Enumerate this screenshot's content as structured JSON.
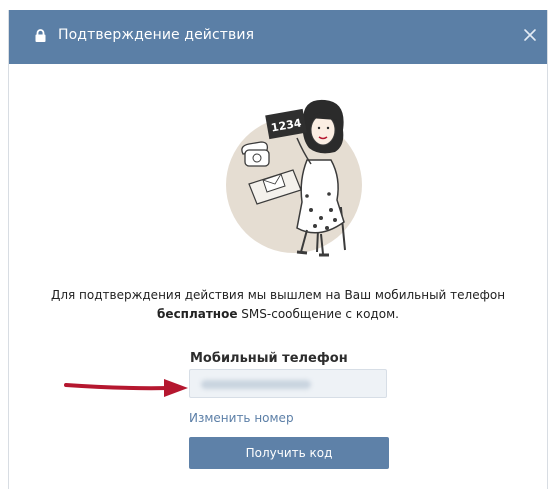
{
  "header": {
    "title": "Подтверждение действия",
    "lock_icon": "lock-icon",
    "close_icon": "close-icon",
    "background": "#5b7fa6"
  },
  "message": {
    "line1": "Для подтверждения действия мы вышлем на Ваш мобильный телефон",
    "bold": "бесплатное",
    "line2_rest": " SMS-сообщение с кодом."
  },
  "illustration": {
    "card_number": "1234",
    "icon": "woman-with-phone-illustration"
  },
  "phone": {
    "label": "Мобильный телефон",
    "value": "",
    "value_hidden": true
  },
  "change_link": "Изменить номер",
  "submit_label": "Получить код",
  "colors": {
    "accent": "#5e81a8",
    "link": "#5c7fa7",
    "arrow": "#b5172f"
  }
}
